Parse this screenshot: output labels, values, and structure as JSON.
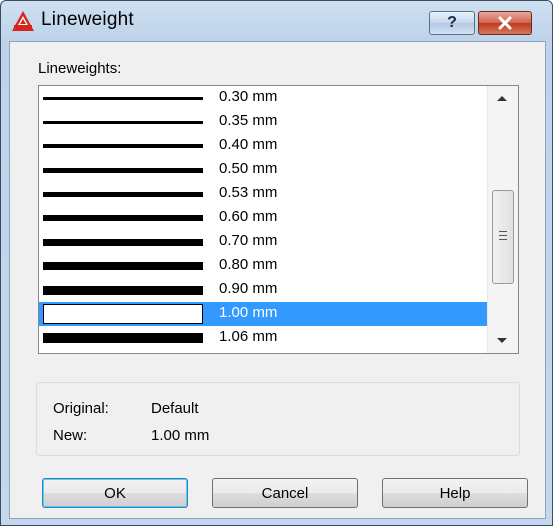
{
  "window": {
    "title": "Lineweight",
    "help_caption": "?",
    "close_caption": "close-x"
  },
  "list_label": "Lineweights:",
  "lineweights": [
    {
      "label": "0.30 mm",
      "weight": 0.3,
      "selected": false
    },
    {
      "label": "0.35 mm",
      "weight": 0.35,
      "selected": false
    },
    {
      "label": "0.40 mm",
      "weight": 0.4,
      "selected": false
    },
    {
      "label": "0.50 mm",
      "weight": 0.5,
      "selected": false
    },
    {
      "label": "0.53 mm",
      "weight": 0.53,
      "selected": false
    },
    {
      "label": "0.60 mm",
      "weight": 0.6,
      "selected": false
    },
    {
      "label": "0.70 mm",
      "weight": 0.7,
      "selected": false
    },
    {
      "label": "0.80 mm",
      "weight": 0.8,
      "selected": false
    },
    {
      "label": "0.90 mm",
      "weight": 0.9,
      "selected": false
    },
    {
      "label": "1.00 mm",
      "weight": 1.0,
      "selected": true
    },
    {
      "label": "1.06 mm",
      "weight": 1.06,
      "selected": false
    }
  ],
  "info": {
    "original_label": "Original:",
    "original_value": "Default",
    "new_label": "New:",
    "new_value": "1.00 mm"
  },
  "buttons": {
    "ok": "OK",
    "cancel": "Cancel",
    "help": "Help"
  },
  "colors": {
    "selection": "#3399ff",
    "close_button": "#c0391d"
  }
}
